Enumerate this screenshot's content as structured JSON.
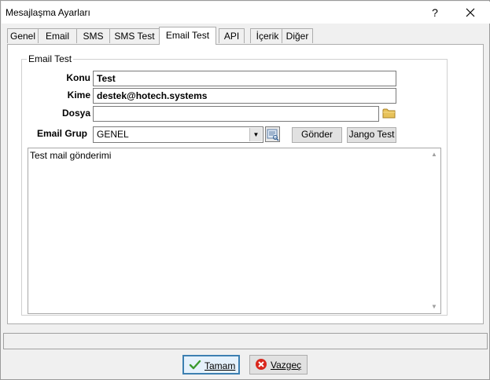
{
  "window": {
    "title": "Mesajlaşma Ayarları",
    "help_label": "?",
    "close_label": "✕"
  },
  "tabs": [
    {
      "label": "Genel"
    },
    {
      "label": "Email"
    },
    {
      "label": "SMS"
    },
    {
      "label": "SMS Test"
    },
    {
      "label": "Email Test",
      "active": true
    },
    {
      "label": "API"
    },
    {
      "label": "İçerik"
    },
    {
      "label": "Diğer"
    }
  ],
  "email_test": {
    "group_title": "Email Test",
    "konu_label": "Konu",
    "konu_value": "Test",
    "kime_label": "Kime",
    "kime_value": "destek@hotech.systems",
    "dosya_label": "Dosya",
    "dosya_value": "",
    "email_grup_label": "Email Grup",
    "email_grup_value": "GENEL",
    "gonder_label": "Gönder",
    "jango_label": "Jango Test",
    "body_text": "Test mail gönderimi"
  },
  "footer": {
    "status_text": "",
    "ok_label": "Tamam",
    "cancel_label": "Vazgeç"
  },
  "icons": {
    "folder": "folder-icon",
    "check": "check-icon",
    "cancel": "cancel-x-icon",
    "lookup": "lookup-icon"
  },
  "colors": {
    "focus_border": "#3c7fb1",
    "cancel_red": "#d9261c",
    "check_green": "#3a9a2e",
    "folder_yellow": "#e8c25a"
  }
}
